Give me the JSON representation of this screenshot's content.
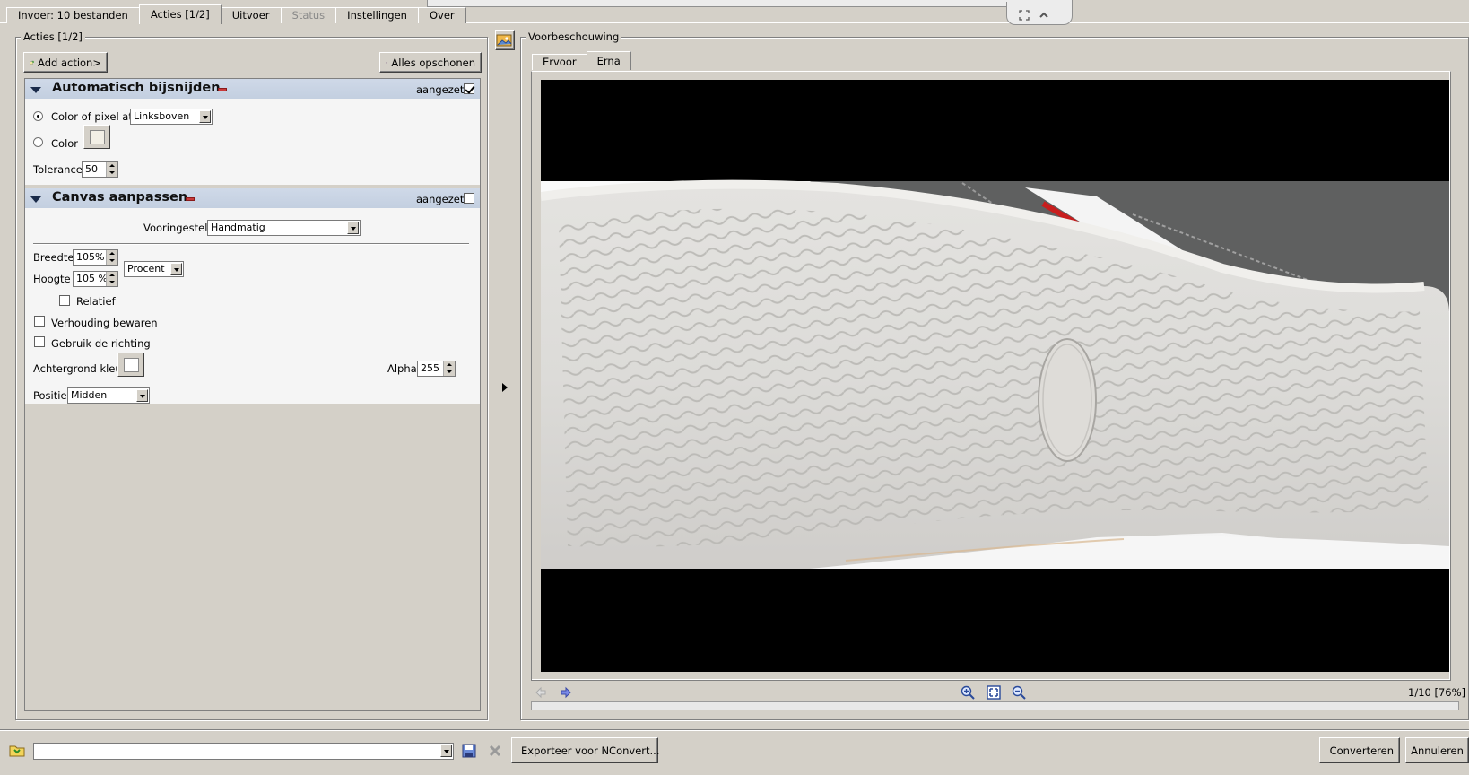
{
  "tabs": [
    {
      "label": "Invoer: 10 bestanden"
    },
    {
      "label": "Acties [1/2]"
    },
    {
      "label": "Uitvoer"
    },
    {
      "label": "Status"
    },
    {
      "label": "Instellingen"
    },
    {
      "label": "Over"
    }
  ],
  "actions_panel": {
    "title": "Acties [1/2]",
    "add_action_label": "Add action>",
    "clear_all_label": "Alles opschonen",
    "autocrop": {
      "title": "Automatisch bijsnijden",
      "enabled_label": "aangezet",
      "enabled": true,
      "color_of_pixel_label": "Color of pixel at",
      "pixel_position": "Linksboven",
      "color_label": "Color",
      "color_value": "#f2efe6",
      "tolerance_label": "Tolerance",
      "tolerance": "50"
    },
    "canvas": {
      "title": "Canvas aanpassen",
      "enabled_label": "aangezet",
      "enabled": false,
      "preset_label": "Vooringesteld",
      "preset": "Handmatig",
      "width_label": "Breedte",
      "width": "105%",
      "height_label": "Hoogte",
      "height": "105 %",
      "unit": "Procent",
      "relative_label": "Relatief",
      "keep_ratio_label": "Verhouding bewaren",
      "use_direction_label": "Gebruik de richting",
      "bg_color_label": "Achtergrond kleur",
      "alpha_label": "Alpha",
      "alpha": "255",
      "position_label": "Positie",
      "position": "Midden"
    }
  },
  "preview": {
    "title": "Voorbeschouwing",
    "tabs": [
      "Ervoor",
      "Erna"
    ],
    "active_tab": "Erna",
    "page_indicator": "1/10 [76%]"
  },
  "bottom": {
    "path_value": "",
    "export_label": "Exporteer voor NConvert...",
    "convert_label": "Converteren",
    "cancel_label": "Annuleren"
  },
  "colors": {
    "window_bg": "#d4d0c8",
    "section_header": "#c7d3e4",
    "panel_bg": "#f5f5f5"
  }
}
